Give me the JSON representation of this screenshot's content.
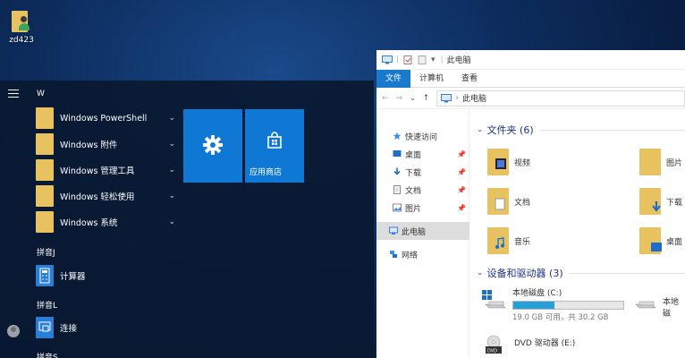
{
  "desktop": {
    "user_icon_label": "zd423"
  },
  "start_menu": {
    "group_w": "W",
    "apps_w": [
      {
        "label": "Windows PowerShell",
        "chevron": "⌄"
      },
      {
        "label": "Windows 附件",
        "chevron": "⌄"
      },
      {
        "label": "Windows 管理工具",
        "chevron": "⌄"
      },
      {
        "label": "Windows 轻松使用",
        "chevron": "⌄"
      },
      {
        "label": "Windows 系统",
        "chevron": "⌄"
      }
    ],
    "group_j": "拼音J",
    "app_calc": "计算器",
    "group_l": "拼音L",
    "app_connect": "连接",
    "group_s": "拼音S",
    "tiles": {
      "settings_label": "",
      "store_label": "应用商店"
    },
    "accent": "#0f78d4"
  },
  "explorer": {
    "title": "此电脑",
    "ribbon_tabs": [
      "文件",
      "计算机",
      "查看"
    ],
    "address": {
      "back": "←",
      "forward": "→",
      "up": "↑",
      "path": "此电脑"
    },
    "nav": [
      {
        "label": "快速访问",
        "pin": ""
      },
      {
        "label": "桌面",
        "pin": "📌"
      },
      {
        "label": "下载",
        "pin": "📌"
      },
      {
        "label": "文档",
        "pin": "📌"
      },
      {
        "label": "图片",
        "pin": "📌"
      },
      {
        "label": "此电脑",
        "pin": ""
      },
      {
        "label": "网络",
        "pin": ""
      }
    ],
    "folders_header": "文件夹 (6)",
    "folders": [
      "视频",
      "图片",
      "文档",
      "下载",
      "音乐",
      "桌面"
    ],
    "devices_header": "设备和驱动器 (3)",
    "drives": [
      {
        "name": "本地磁盘 (C:)",
        "usage": "19.0 GB 可用，共 30.2 GB",
        "used_fraction": 0.37
      },
      {
        "name": "本地磁"
      },
      {
        "name": "DVD 驱动器 (E:)"
      }
    ],
    "accent": "#1979ca"
  }
}
